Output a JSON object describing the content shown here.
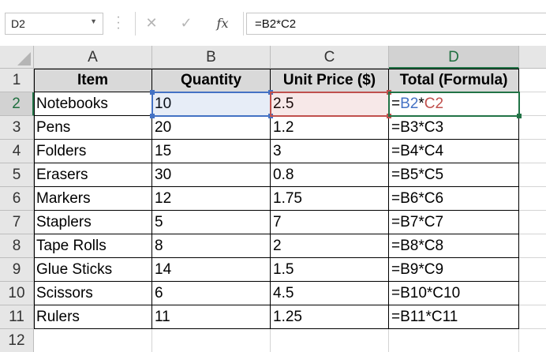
{
  "formula_bar": {
    "name_box": "D2",
    "cancel_icon": "✕",
    "enter_icon": "✓",
    "fx_label": "fx",
    "formula": "=B2*C2"
  },
  "columns": [
    "A",
    "B",
    "C",
    "D"
  ],
  "rows": [
    "1",
    "2",
    "3",
    "4",
    "5",
    "6",
    "7",
    "8",
    "9",
    "10",
    "11",
    "12"
  ],
  "table": {
    "headers": [
      "Item",
      "Quantity",
      "Unit Price ($)",
      "Total (Formula)"
    ],
    "rows": [
      [
        "Notebooks",
        "10",
        "2.5",
        "=B2*C2"
      ],
      [
        "Pens",
        "20",
        "1.2",
        "=B3*C3"
      ],
      [
        "Folders",
        "15",
        "3",
        "=B4*C4"
      ],
      [
        "Erasers",
        "30",
        "0.8",
        "=B5*C5"
      ],
      [
        "Markers",
        "12",
        "1.75",
        "=B6*C6"
      ],
      [
        "Staplers",
        "5",
        "7",
        "=B7*C7"
      ],
      [
        "Tape Rolls",
        "8",
        "2",
        "=B8*C8"
      ],
      [
        "Glue Sticks",
        "14",
        "1.5",
        "=B9*C9"
      ],
      [
        "Scissors",
        "6",
        "4.5",
        "=B10*C10"
      ],
      [
        "Rulers",
        "11",
        "1.25",
        "=B11*C11"
      ]
    ]
  },
  "active_formula_parts": {
    "eq": "=",
    "ref1": "B2",
    "op": "*",
    "ref2": "C2"
  },
  "colors": {
    "accent": "#217346",
    "ref_blue": "#4472c4",
    "ref_red": "#c0504d",
    "header_fill": "#d9d9d9"
  }
}
